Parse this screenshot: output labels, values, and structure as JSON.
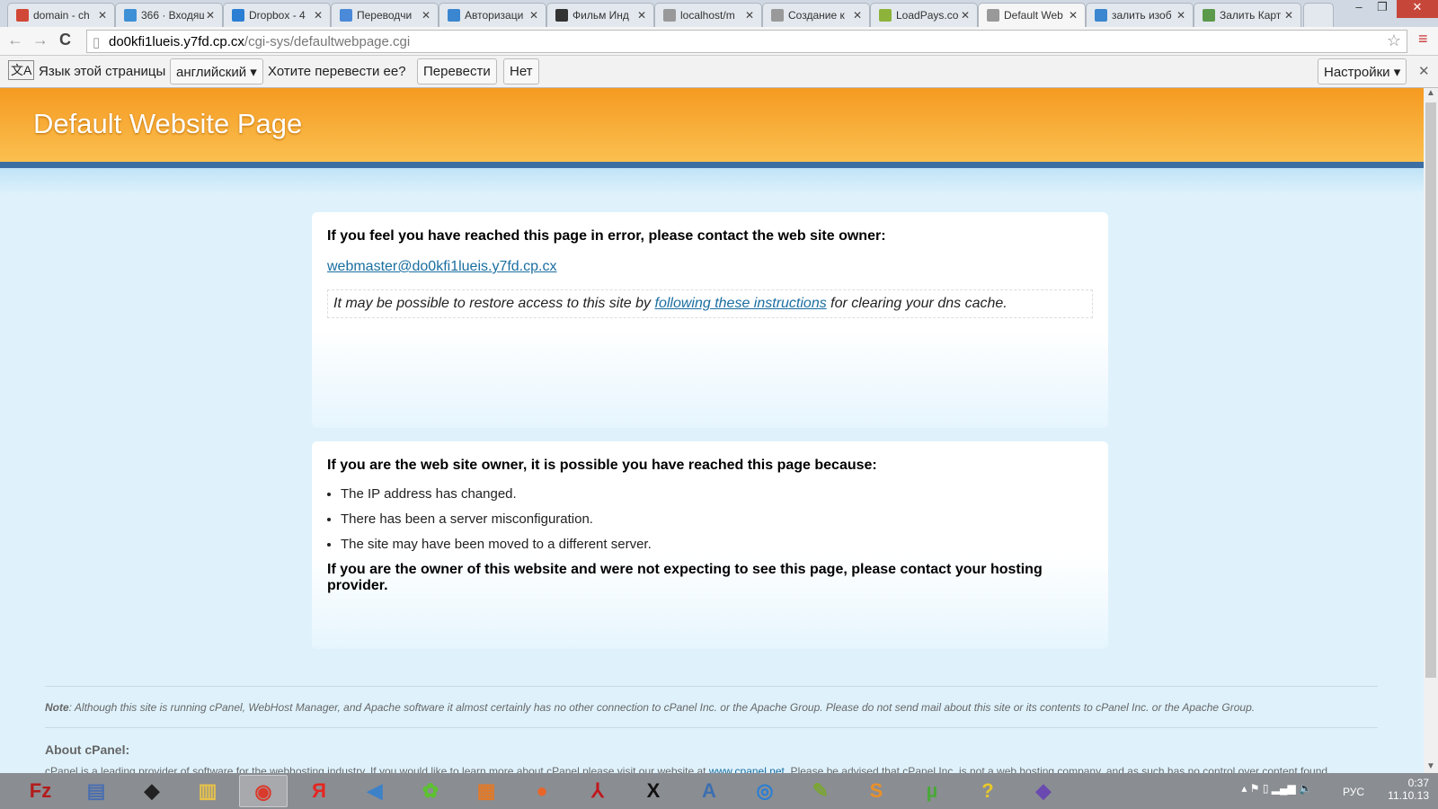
{
  "tabs": [
    {
      "label": "domain - ch",
      "icon": "gmail-icon",
      "color": "#d14836"
    },
    {
      "label": "366 · Входящ",
      "icon": "mail-icon",
      "color": "#3d8fd6"
    },
    {
      "label": "Dropbox - 4",
      "icon": "dropbox-icon",
      "color": "#2a7fd4"
    },
    {
      "label": "Переводчи",
      "icon": "translate-icon",
      "color": "#4a8ad8"
    },
    {
      "label": "Авторизаци",
      "icon": "check-icon",
      "color": "#3b86d0"
    },
    {
      "label": "Фильм Инд",
      "icon": "film-icon",
      "color": "#333333"
    },
    {
      "label": "localhost/m",
      "icon": "page-icon",
      "color": "#999999"
    },
    {
      "label": "Создание к",
      "icon": "page-icon",
      "color": "#999999"
    },
    {
      "label": "LoadPays.co",
      "icon": "lp-icon",
      "color": "#8db33a"
    },
    {
      "label": "Default Web",
      "icon": "page-icon",
      "color": "#999999",
      "active": true
    },
    {
      "label": "залить изоб",
      "icon": "loading-icon",
      "color": "#3b86d0"
    },
    {
      "label": "Залить Карт",
      "icon": "image-icon",
      "color": "#5a9a4a"
    }
  ],
  "address": {
    "host": "do0kfi1lueis.y7fd.cp.cx",
    "path": "/cgi-sys/defaultwebpage.cgi"
  },
  "translate": {
    "prefix": "Язык этой страницы",
    "language": "английский",
    "question": "Хотите перевести ее?",
    "translate_btn": "Перевести",
    "no_btn": "Нет",
    "settings_btn": "Настройки"
  },
  "page": {
    "title": "Default Website Page",
    "box1": {
      "heading": "If you feel you have reached this page in error, please contact the web site owner:",
      "email": "webmaster@do0kfi1lueis.y7fd.cp.cx",
      "tip_before": "It may be possible to restore access to this site by ",
      "tip_link": "following these instructions",
      "tip_after": " for clearing your dns cache."
    },
    "box2": {
      "heading": "If you are the web site owner, it is possible you have reached this page because:",
      "reasons": [
        "The IP address has changed.",
        "There has been a server misconfiguration.",
        "The site may have been moved to a different server."
      ],
      "closing": "If you are the owner of this website and were not expecting to see this page, please contact your hosting provider."
    },
    "note_label": "Note",
    "note": ": Although this site is running cPanel, WebHost Manager, and Apache software it almost certainly has no other connection to cPanel Inc. or the Apache Group. Please do not send mail about this site or its contents to cPanel Inc. or the Apache Group.",
    "about_heading": "About cPanel:",
    "about_before": "cPanel is a leading provider of software for the webhosting industry. If you would like to learn more about cPanel please visit our website at ",
    "about_link": "www.cpanel.net",
    "about_after": ". Please be advised that cPanel Inc. is not a web hosting company, and as such has no control over content found"
  },
  "taskbar": {
    "apps": [
      {
        "name": "filezilla",
        "glyph": "Fz",
        "color": "#b31b1b"
      },
      {
        "name": "video-editor",
        "glyph": "▤",
        "color": "#4a6fb0"
      },
      {
        "name": "inkscape",
        "glyph": "◆",
        "color": "#222222"
      },
      {
        "name": "file-explorer",
        "glyph": "▥",
        "color": "#e8c24a"
      },
      {
        "name": "chrome",
        "glyph": "◉",
        "color": "#d93a2b"
      },
      {
        "name": "yandex",
        "glyph": "Я",
        "color": "#e52620"
      },
      {
        "name": "audio",
        "glyph": "◀",
        "color": "#3d82c8"
      },
      {
        "name": "icq",
        "glyph": "✿",
        "color": "#5cc22f"
      },
      {
        "name": "paint",
        "glyph": "▦",
        "color": "#e07a2a"
      },
      {
        "name": "firefox",
        "glyph": "●",
        "color": "#e8652a"
      },
      {
        "name": "acrobat",
        "glyph": "⅄",
        "color": "#c0171c"
      },
      {
        "name": "xmind",
        "glyph": "X",
        "color": "#111111"
      },
      {
        "name": "wordpad",
        "glyph": "A",
        "color": "#3d6fb0"
      },
      {
        "name": "disc-burner",
        "glyph": "◎",
        "color": "#2a7fd4"
      },
      {
        "name": "notepad-plus",
        "glyph": "✎",
        "color": "#7aa630"
      },
      {
        "name": "sublime",
        "glyph": "S",
        "color": "#e8902a"
      },
      {
        "name": "utorrent",
        "glyph": "µ",
        "color": "#4aa83a"
      },
      {
        "name": "help",
        "glyph": "?",
        "color": "#e8c82a"
      },
      {
        "name": "gem",
        "glyph": "◆",
        "color": "#6a4ab0"
      }
    ],
    "lang": "РУС",
    "time": "0:37",
    "date": "11.10.13"
  }
}
